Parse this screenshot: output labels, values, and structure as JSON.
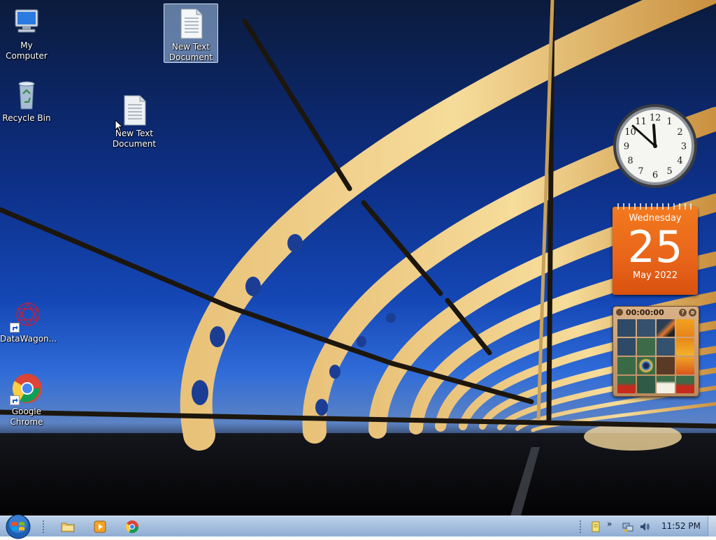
{
  "desktop": {
    "icons": [
      {
        "label": "My Computer",
        "icon": "computer-icon"
      },
      {
        "label": "Recycle Bin",
        "icon": "recycle-bin-icon"
      },
      {
        "label": "New Text Document",
        "icon": "text-document-icon"
      },
      {
        "label": "New Text Document",
        "icon": "text-document-icon"
      },
      {
        "label": "DataWagon...",
        "icon": "datawagon-icon"
      },
      {
        "label": "Google Chrome",
        "icon": "chrome-icon"
      }
    ]
  },
  "gadgets": {
    "clock": {
      "hour": 11,
      "minute": 52,
      "numbers": [
        "12",
        "1",
        "2",
        "3",
        "4",
        "5",
        "6",
        "7",
        "8",
        "9",
        "10",
        "11"
      ]
    },
    "calendar": {
      "weekday": "Wednesday",
      "day": "25",
      "month_year": "May 2022"
    },
    "puzzle": {
      "timer": "00:00:00",
      "help": "?",
      "close": "⊗"
    }
  },
  "taskbar": {
    "start_icon": "windows-logo-icon",
    "pinned": [
      {
        "name": "explorer",
        "icon": "folder-icon"
      },
      {
        "name": "media-player",
        "icon": "media-player-icon"
      },
      {
        "name": "chrome",
        "icon": "chrome-icon"
      }
    ],
    "tray": {
      "expand": "»",
      "icons": [
        "notes-icon",
        "network-icon",
        "volume-icon"
      ]
    },
    "time": "11:52 PM"
  },
  "colors": {
    "taskbar": "#a7c0de",
    "calendar": "#e8641a"
  }
}
